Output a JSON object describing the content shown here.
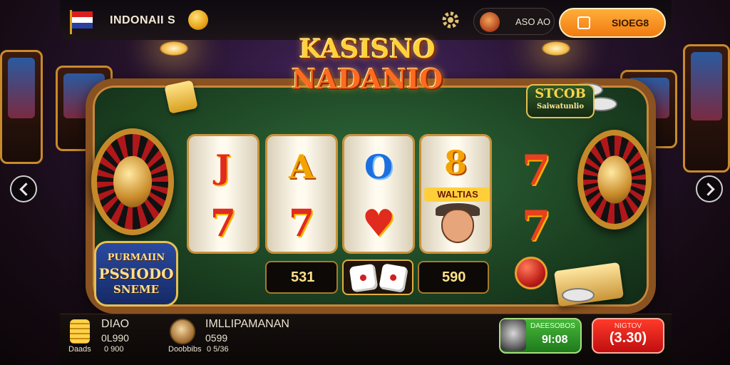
{
  "header": {
    "country_label": "INDONAII S",
    "account_label": "ASO AO",
    "cta_label": "SIOEG8"
  },
  "game": {
    "title_line1": "KASISNO",
    "title_line2": "NADANIO",
    "reels": [
      {
        "top": "J",
        "bottom": "7"
      },
      {
        "top": "A",
        "bottom": "7"
      },
      {
        "top": "O",
        "bottom": "♥"
      },
      {
        "top": "8",
        "ribbon": "WALTIAS",
        "bottom": ""
      }
    ],
    "extra_column": [
      "7",
      "7"
    ],
    "bet_left": "531",
    "bet_right": "590",
    "badge_left": {
      "line1": "PURMAIIN",
      "line2": "PSSIODO",
      "line3": "SNEME"
    },
    "badge_right": {
      "line1": "STCOB",
      "line2": "Saiwatunlio"
    }
  },
  "footer": {
    "player1": {
      "name": "DIAO",
      "amount": "0L990",
      "sub_label": "Daads",
      "sub_value": "0 900"
    },
    "player2": {
      "name": "IMLLIPAMANAN",
      "amount": "0599",
      "sub_label": "Doobbibs",
      "sub_value": "0 5/36"
    },
    "green_button": {
      "label": "DAEESOBOS",
      "value": "9I:08"
    },
    "red_button": {
      "label": "NIGTOV",
      "value": "(3.30)"
    }
  },
  "colors": {
    "accent_orange": "#f07a10",
    "felt_green": "#1c4222",
    "gold": "#ffd23a",
    "red": "#e02b1e"
  }
}
